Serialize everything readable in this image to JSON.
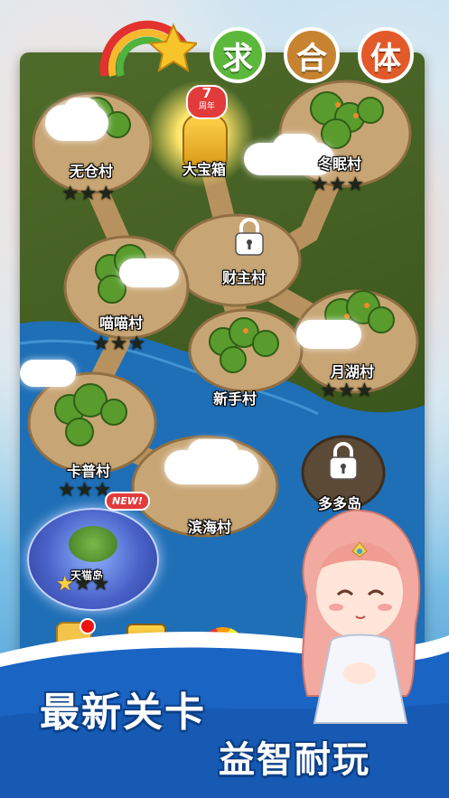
{
  "title": {
    "chars": [
      "求",
      "合",
      "体"
    ],
    "colors": [
      "#5bb83a",
      "#c7832f",
      "#e35a2a"
    ]
  },
  "anniversary_badge": {
    "number": "7",
    "text": "周年"
  },
  "villages": [
    {
      "id": "wucang",
      "label": "无仓村",
      "stars_lit": 0
    },
    {
      "id": "dabaoxiang",
      "label": "大宝箱"
    },
    {
      "id": "dongmian",
      "label": "冬眠村",
      "stars_lit": 0
    },
    {
      "id": "caizhu",
      "label": "财主村",
      "locked": true
    },
    {
      "id": "miaomiao",
      "label": "喵喵村",
      "stars_lit": 0
    },
    {
      "id": "yuehu",
      "label": "月湖村",
      "stars_lit": 0
    },
    {
      "id": "xinshou",
      "label": "新手村"
    },
    {
      "id": "kapu",
      "label": "卡普村",
      "stars_lit": 0
    },
    {
      "id": "binhai",
      "label": "滨海村"
    },
    {
      "id": "duoduodao",
      "label": "多多岛",
      "locked": true
    },
    {
      "id": "tianmaodao",
      "label": "天猫岛",
      "badge": "NEW!",
      "stars_lit": 1
    }
  ],
  "promo": {
    "line1": "最新关卡",
    "line2": "益智耐玩"
  },
  "colors": {
    "water": "#1f6fb6",
    "land": "#c8a574",
    "grass": "#4f6b2a",
    "star_lit": "#ffd23a"
  }
}
